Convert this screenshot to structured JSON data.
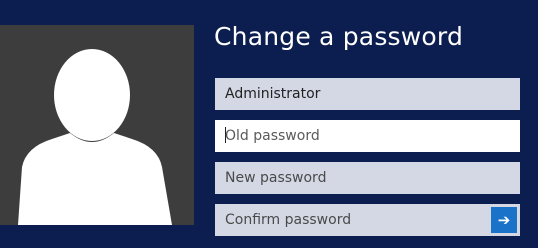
{
  "page": {
    "title": "Change a password"
  },
  "user": {
    "name": "Administrator"
  },
  "fields": {
    "old_password_placeholder": "Old password",
    "new_password_placeholder": "New password",
    "confirm_password_placeholder": "Confirm password"
  },
  "icons": {
    "avatar": "user-silhouette-icon",
    "submit": "arrow-right-icon"
  },
  "colors": {
    "background": "#0b1e4f",
    "tile": "#3d3d3d",
    "field": "#d3d8e4",
    "accent": "#1a73c9"
  }
}
